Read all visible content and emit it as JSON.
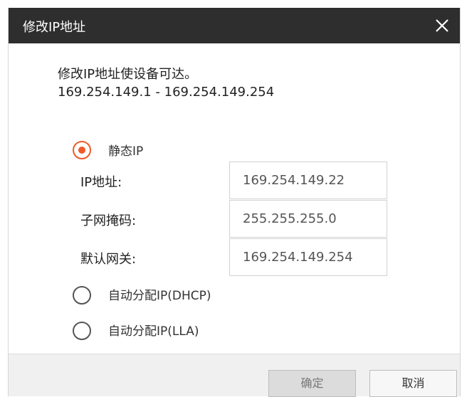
{
  "dialog": {
    "title": "修改IP地址",
    "description_line1": "修改IP地址使设备可达。",
    "description_line2": "169.254.149.1 - 169.254.149.254"
  },
  "options": {
    "static_label": "静态IP",
    "dhcp_label": "自动分配IP(DHCP)",
    "lla_label": "自动分配IP(LLA)",
    "selected": "static"
  },
  "fields": {
    "ip_label": "IP地址:",
    "ip_value": "169.254.149.22",
    "mask_label": "子网掩码:",
    "mask_value": "255.255.255.0",
    "gateway_label": "默认网关:",
    "gateway_value": "169.254.149.254"
  },
  "buttons": {
    "ok_label": "确定",
    "cancel_label": "取消"
  },
  "colors": {
    "accent": "#f05a28",
    "titlebar": "#2e2e2e"
  },
  "icons": {
    "close": "close-icon",
    "radio_selected": "radio-selected-icon",
    "radio_unselected": "radio-unselected-icon"
  }
}
